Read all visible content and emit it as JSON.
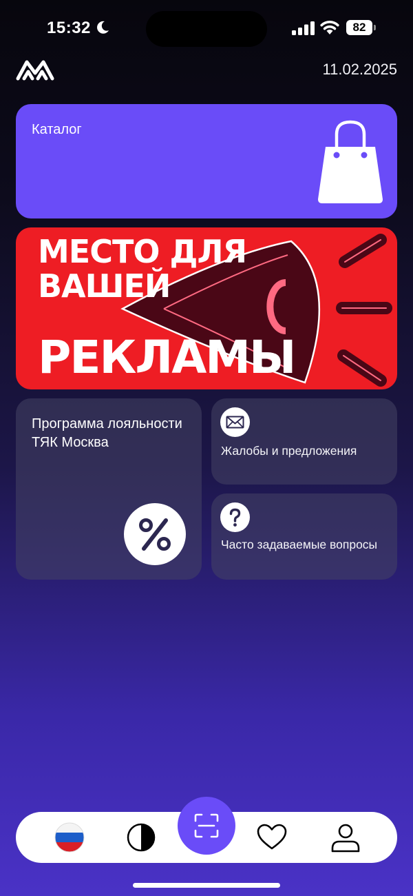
{
  "status_bar": {
    "time": "15:32",
    "battery": "82",
    "icons": [
      "moon-icon",
      "signal-icon",
      "wifi-icon",
      "battery-icon"
    ]
  },
  "header": {
    "logo_icon": "metro-logo-icon",
    "date": "11.02.2025"
  },
  "catalog": {
    "label": "Каталог",
    "icon": "shopping-bag-icon"
  },
  "ad_banner": {
    "line1": "МЕСТО ДЛЯ",
    "line2": "ВАШЕЙ",
    "line3": "РЕКЛАМЫ"
  },
  "loyalty": {
    "label": "Программа лояльности ТЯК Москва",
    "icon": "percent-icon"
  },
  "complaints": {
    "label": "Жалобы и предложения",
    "icon": "envelope-icon"
  },
  "faq": {
    "label": "Часто задаваемые вопросы",
    "icon": "question-icon"
  },
  "bottom_nav": {
    "items": [
      "russian-flag-icon",
      "theme-toggle-icon",
      "scan-icon",
      "heart-icon",
      "profile-icon"
    ]
  },
  "colors": {
    "accent": "#6a4cf8",
    "ad_red": "#ee1d24",
    "background_dark": "#07060d",
    "background_light": "#4a32c6"
  }
}
